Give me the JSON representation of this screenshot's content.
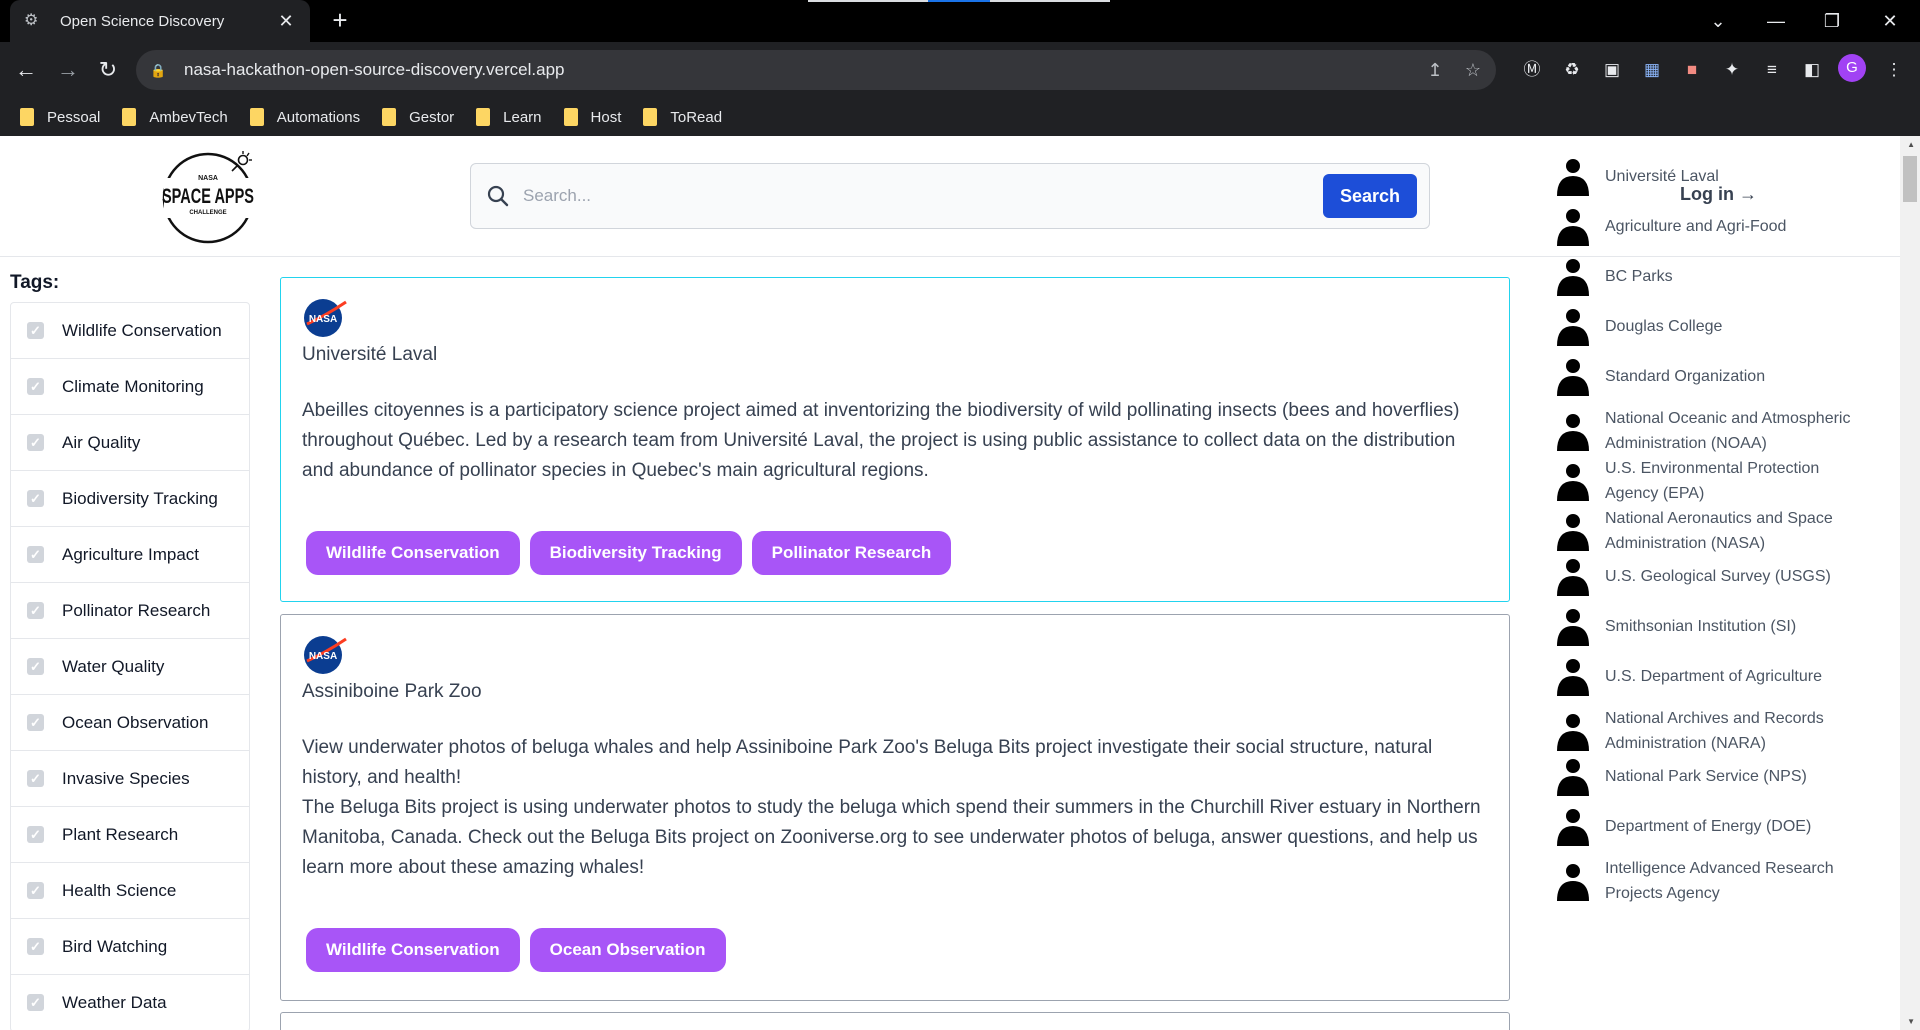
{
  "browser": {
    "tab_title": "Open Science Discovery",
    "url": "nasa-hackathon-open-source-discovery.vercel.app",
    "profile_initial": "G",
    "bookmarks": [
      "Pessoal",
      "AmbevTech",
      "Automations",
      "Gestor",
      "Learn",
      "Host",
      "ToRead"
    ]
  },
  "header": {
    "logo_top": "NASA",
    "logo_main": "SPACE APPS",
    "logo_bottom": "CHALLENGE",
    "search_placeholder": "Search...",
    "search_button": "Search",
    "login_label": "Log in →"
  },
  "tags": {
    "title": "Tags:",
    "items": [
      "Wildlife Conservation",
      "Climate Monitoring",
      "Air Quality",
      "Biodiversity Tracking",
      "Agriculture Impact",
      "Pollinator Research",
      "Water Quality",
      "Ocean Observation",
      "Invasive Species",
      "Plant Research",
      "Health Science",
      "Bird Watching",
      "Weather Data"
    ]
  },
  "projects": [
    {
      "logo": "NASA",
      "org": "Université Laval",
      "description": "Abeilles citoyennes is a participatory science project aimed at inventorizing the biodiversity of wild pollinating insects (bees and hoverflies) throughout Québec. Led by a research team from Université Laval, the project is using public assistance to collect data on the distribution and abundance of pollinator species in Quebec's main agricultural regions.",
      "tags": [
        "Wildlife Conservation",
        "Biodiversity Tracking",
        "Pollinator Research"
      ]
    },
    {
      "logo": "NASA",
      "org": "Assiniboine Park Zoo",
      "description": "View underwater photos of beluga whales and help Assiniboine Park Zoo's Beluga Bits project investigate their social structure, natural history, and health!",
      "description_2": "The Beluga Bits project is using underwater photos to study the beluga which spend their summers in the Churchill River estuary in Northern Manitoba, Canada. Check out the Beluga Bits project on Zooniverse.org to see underwater photos of beluga, answer questions, and help us learn more about these amazing whales!",
      "tags": [
        "Wildlife Conservation",
        "Ocean Observation"
      ]
    }
  ],
  "organizations": [
    "Université Laval",
    "Agriculture and Agri-Food",
    "BC Parks",
    "Douglas College",
    "Standard Organization",
    "National Oceanic and Atmospheric Administration (NOAA)",
    "U.S. Environmental Protection Agency (EPA)",
    "National Aeronautics and Space Administration (NASA)",
    "U.S. Geological Survey (USGS)",
    "Smithsonian Institution (SI)",
    "U.S. Department of Agriculture",
    "National Archives and Records Administration (NARA)",
    "National Park Service (NPS)",
    "Department of Energy (DOE)",
    "Intelligence Advanced Research Projects Agency"
  ],
  "colors": {
    "accent_blue": "#1d4ed8",
    "tag_purple": "#a855f7",
    "selected_border": "#22d3ee"
  }
}
